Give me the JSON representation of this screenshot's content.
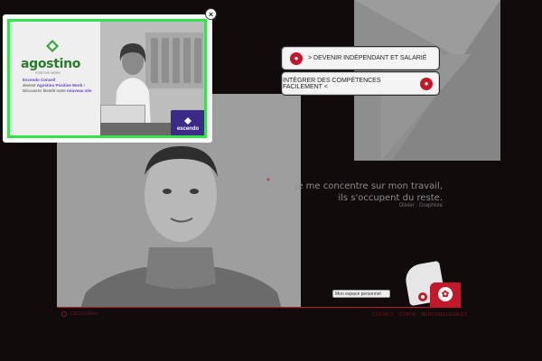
{
  "ctas": {
    "primary": "> DEVENIR INDÉPENDANT ET SALARIÉ",
    "secondary": "INTÉGRER DES COMPÉTENCES FACILEMENT <"
  },
  "quote": {
    "text": "Je me concentre sur mon travail, ils s'occupent du reste.",
    "author": "Olivier · Graphiste"
  },
  "espace": {
    "label": "Mon espace personnel"
  },
  "footer": {
    "left_text": "CECOSeRem",
    "links": [
      "CONTACT",
      "CITATIS",
      "MENTIONS LÉGALES"
    ]
  },
  "popup": {
    "close_glyph": "×",
    "brand": "agostino",
    "brand_sub": "POSITIVE WORK",
    "line1": "Escendo Conseil",
    "line2_pre": "devient ",
    "line2_strong": "Agostino Positive Work",
    "line2_post": " !",
    "line3_pre": "Découvrez bientôt notre ",
    "line3_strong": "nouveau site",
    "badge": "escendo"
  },
  "colors": {
    "accent_red": "#c2182a",
    "popup_border_green": "#34e34a",
    "brand_green": "#2a7a2a",
    "badge_purple": "#3b2a88"
  },
  "icons": {
    "cta_primary_icon": "person-icon",
    "cta_secondary_icon": "group-icon",
    "close_icon": "close-icon"
  }
}
